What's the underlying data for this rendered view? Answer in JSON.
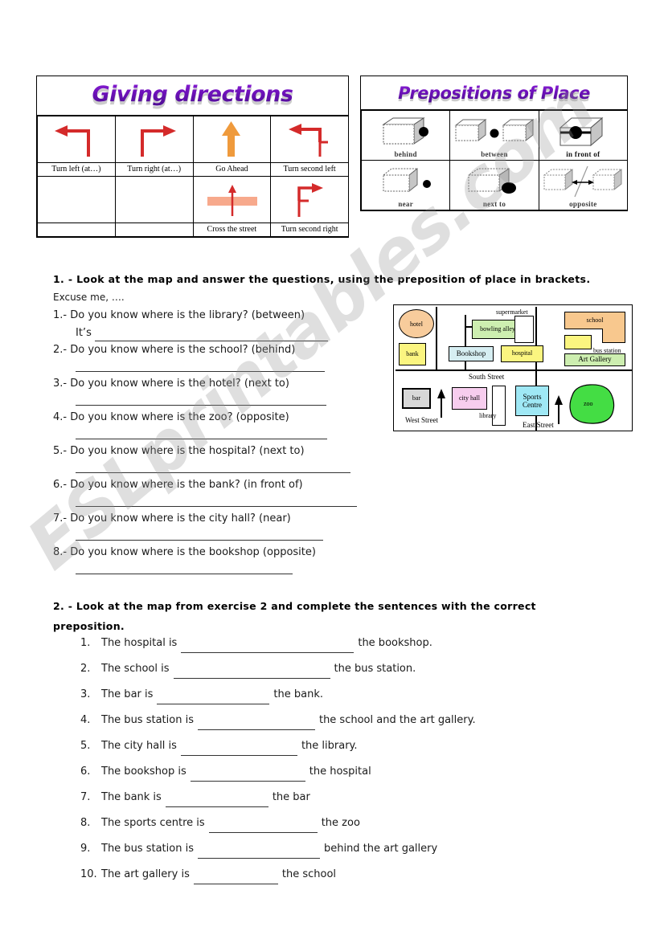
{
  "watermark": {
    "text": "ESLprintables.com"
  },
  "directions_box": {
    "title": "Giving directions",
    "cells": [
      {
        "icon": "turn-left-arrow",
        "label": "Turn left (at…)"
      },
      {
        "icon": "turn-right-arrow",
        "label": "Turn right (at…)"
      },
      {
        "icon": "go-ahead-arrow",
        "label": "Go Ahead"
      },
      {
        "icon": "turn-second-left-arrow",
        "label": "Turn second left"
      },
      {
        "icon": "",
        "label": ""
      },
      {
        "icon": "",
        "label": ""
      },
      {
        "icon": "cross-the-street-arrow",
        "label": "Cross the street"
      },
      {
        "icon": "turn-second-right-arrow",
        "label": "Turn second right"
      }
    ]
  },
  "prepositions_box": {
    "title": "Prepositions of Place",
    "items": [
      {
        "icon": "cube-behind-diagram",
        "label": "behind"
      },
      {
        "icon": "cube-between-diagram",
        "label": "between"
      },
      {
        "icon": "cube-in-front-of-diagram",
        "label": "in front of"
      },
      {
        "icon": "cube-near-diagram",
        "label": "near"
      },
      {
        "icon": "cube-next-to-diagram",
        "label": "next to"
      },
      {
        "icon": "cube-opposite-diagram",
        "label": "opposite"
      }
    ]
  },
  "exercise1": {
    "heading": "1. - Look at the map and answer the questions, using the preposition of place in brackets.",
    "intro": "Excuse me, ….",
    "questions": [
      {
        "num": "1.-",
        "text": "Do you know where is the library? (between)",
        "answer_prefix": "It’s"
      },
      {
        "num": "2.-",
        "text": "Do you know where is the school? (behind)",
        "answer_prefix": ""
      },
      {
        "num": "3.-",
        "text": "Do you know where is the hotel? (next to)",
        "answer_prefix": ""
      },
      {
        "num": "4.-",
        "text": "Do you know where is the zoo? (opposite)",
        "answer_prefix": ""
      },
      {
        "num": "5.-",
        "text": "Do you know where is the hospital? (next to)",
        "answer_prefix": ""
      },
      {
        "num": "6.-",
        "text": "Do you know where is the bank? (in front of)",
        "answer_prefix": ""
      },
      {
        "num": "7.-",
        "text": "Do you know where is the city hall? (near)",
        "answer_prefix": ""
      },
      {
        "num": "8.-",
        "text": "Do you know where is the bookshop (opposite)",
        "answer_prefix": ""
      }
    ]
  },
  "exercise2": {
    "heading": "2. - Look at the map from exercise 2 and complete the sentences with the correct preposition.",
    "sentences": [
      {
        "num": "1.",
        "before": "The hospital is",
        "blank_width": 215,
        "after": "the bookshop."
      },
      {
        "num": "2.",
        "before": "The school is",
        "blank_width": 195,
        "after": "the bus station."
      },
      {
        "num": "3.",
        "before": "The bar is",
        "blank_width": 140,
        "after": "the bank."
      },
      {
        "num": "4.",
        "before": "The bus station is",
        "blank_width": 146,
        "after": "the school and the art gallery."
      },
      {
        "num": "5.",
        "before": "The city hall is",
        "blank_width": 145,
        "after": "the library."
      },
      {
        "num": "6.",
        "before": "The bookshop is",
        "blank_width": 143,
        "after": "the hospital"
      },
      {
        "num": "7.",
        "before": "The bank is",
        "blank_width": 128,
        "after": "the bar"
      },
      {
        "num": "8.",
        "before": "The sports centre is",
        "blank_width": 135,
        "after": "the zoo"
      },
      {
        "num": "9.",
        "before": "The bus station is",
        "blank_width": 152,
        "after": "behind the art gallery"
      },
      {
        "num": "10.",
        "before": "The art gallery is",
        "blank_width": 105,
        "after": "the school"
      }
    ]
  },
  "map": {
    "buildings": [
      {
        "name": "hotel",
        "label": "hotel",
        "color": "#f8cc9c"
      },
      {
        "name": "bank",
        "label": "bank",
        "color": "#fbf580"
      },
      {
        "name": "bowling-alley",
        "label": "bowling alley",
        "color": "#cdeeb0"
      },
      {
        "name": "supermarket",
        "label": "supermarket",
        "color": "#ffffff"
      },
      {
        "name": "bookshop",
        "label": "Bookshop",
        "color": "#d6eef2"
      },
      {
        "name": "hospital",
        "label": "hospital",
        "color": "#fbf580"
      },
      {
        "name": "school",
        "label": "school",
        "color": "#f8c88e"
      },
      {
        "name": "bus-station",
        "label": "bus station",
        "color": "#fbf580"
      },
      {
        "name": "art-gallery",
        "label": "Art Gallery",
        "color": "#cdeeb0"
      },
      {
        "name": "bar",
        "label": "bar",
        "color": "#d8d8d8"
      },
      {
        "name": "city-hall",
        "label": "city hall",
        "color": "#f7cdee"
      },
      {
        "name": "library",
        "label": "library",
        "color": "#ffffff"
      },
      {
        "name": "sports-centre",
        "label": "Sports Centre",
        "color": "#9fe8f5"
      },
      {
        "name": "zoo",
        "label": "zoo",
        "color": "#44dd44"
      }
    ],
    "streets": [
      {
        "name": "south-street",
        "label": "South Street"
      },
      {
        "name": "west-street",
        "label": "West Street"
      },
      {
        "name": "east-street",
        "label": "East Street"
      }
    ],
    "labels": {
      "hotel": "hotel",
      "bank": "bank",
      "bowling_alley": "bowling alley",
      "supermarket": "supermarket",
      "bookshop": "Bookshop",
      "hospital": "hospital",
      "school": "school",
      "bus_station": "bus station",
      "art_gallery": "Art Gallery",
      "bar": "bar",
      "city_hall": "city hall",
      "library": "library",
      "sports_centre_1": "Sports",
      "sports_centre_2": "Centre",
      "zoo": "zoo",
      "south_street": "South Street",
      "west_street": "West Street",
      "east_street": "East Street"
    }
  }
}
